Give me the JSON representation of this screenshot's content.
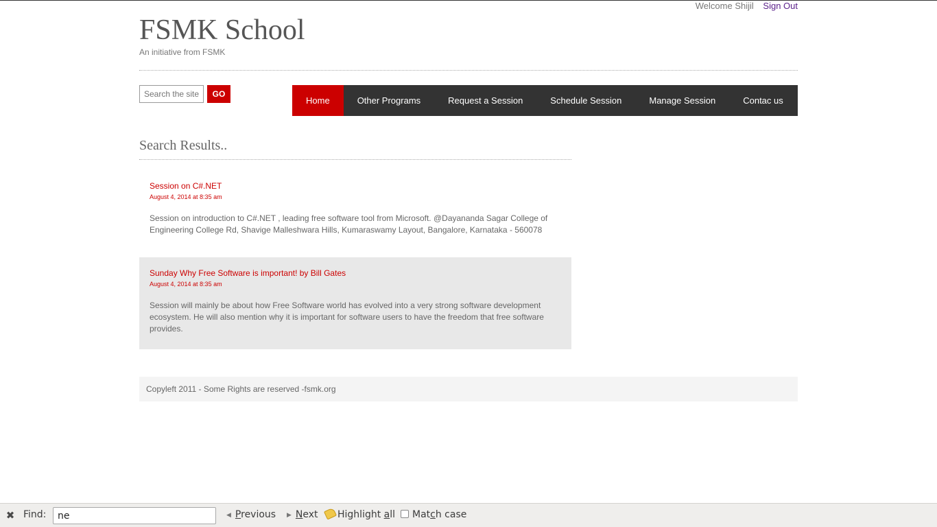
{
  "userbar": {
    "welcome": "Welcome Shijil",
    "signout": "Sign Out"
  },
  "site": {
    "title": "FSMK School",
    "tagline": "An initiative from FSMK"
  },
  "search": {
    "placeholder": "Search the site",
    "go_label": "GO"
  },
  "nav": {
    "items": [
      {
        "label": "Home",
        "active": true
      },
      {
        "label": "Other Programs",
        "active": false
      },
      {
        "label": "Request a Session",
        "active": false
      },
      {
        "label": "Schedule Session",
        "active": false
      },
      {
        "label": "Manage Session",
        "active": false
      },
      {
        "label": "Contac us",
        "active": false
      }
    ]
  },
  "results": {
    "heading": "Search Results..",
    "items": [
      {
        "title": "Session on C#.NET",
        "date": "August 4, 2014 at 8:35 am",
        "description": "Session on introduction to C#.NET , leading free software tool from Microsoft. @Dayananda Sagar College of Engineering College Rd, Shavige Malleshwara Hills, Kumaraswamy Layout, Bangalore, Karnataka - 560078"
      },
      {
        "title": "Sunday Why Free Software is important! by Bill Gates",
        "date": "August 4, 2014 at 8:35 am",
        "description": "Session will mainly be about how Free Software world has evolved into a very strong software development ecosystem. He will also mention why it is important for software users to have the freedom that free software provides."
      }
    ]
  },
  "footer": {
    "text": "Copyleft 2011 - Some Rights are reserved -fsmk.org"
  },
  "findbar": {
    "label": "Find:",
    "value": "ne",
    "previous": {
      "underlined": "P",
      "rest": "revious"
    },
    "next": {
      "underlined": "N",
      "rest": "ext"
    },
    "highlight": {
      "before": "Highlight ",
      "underlined": "a",
      "after": "ll"
    },
    "match_case": {
      "before": "Mat",
      "underlined": "c",
      "after": "h case"
    }
  },
  "colors": {
    "accent": "#cc0000",
    "nav_bg": "#333333",
    "link_visited": "#5a1f8a"
  }
}
